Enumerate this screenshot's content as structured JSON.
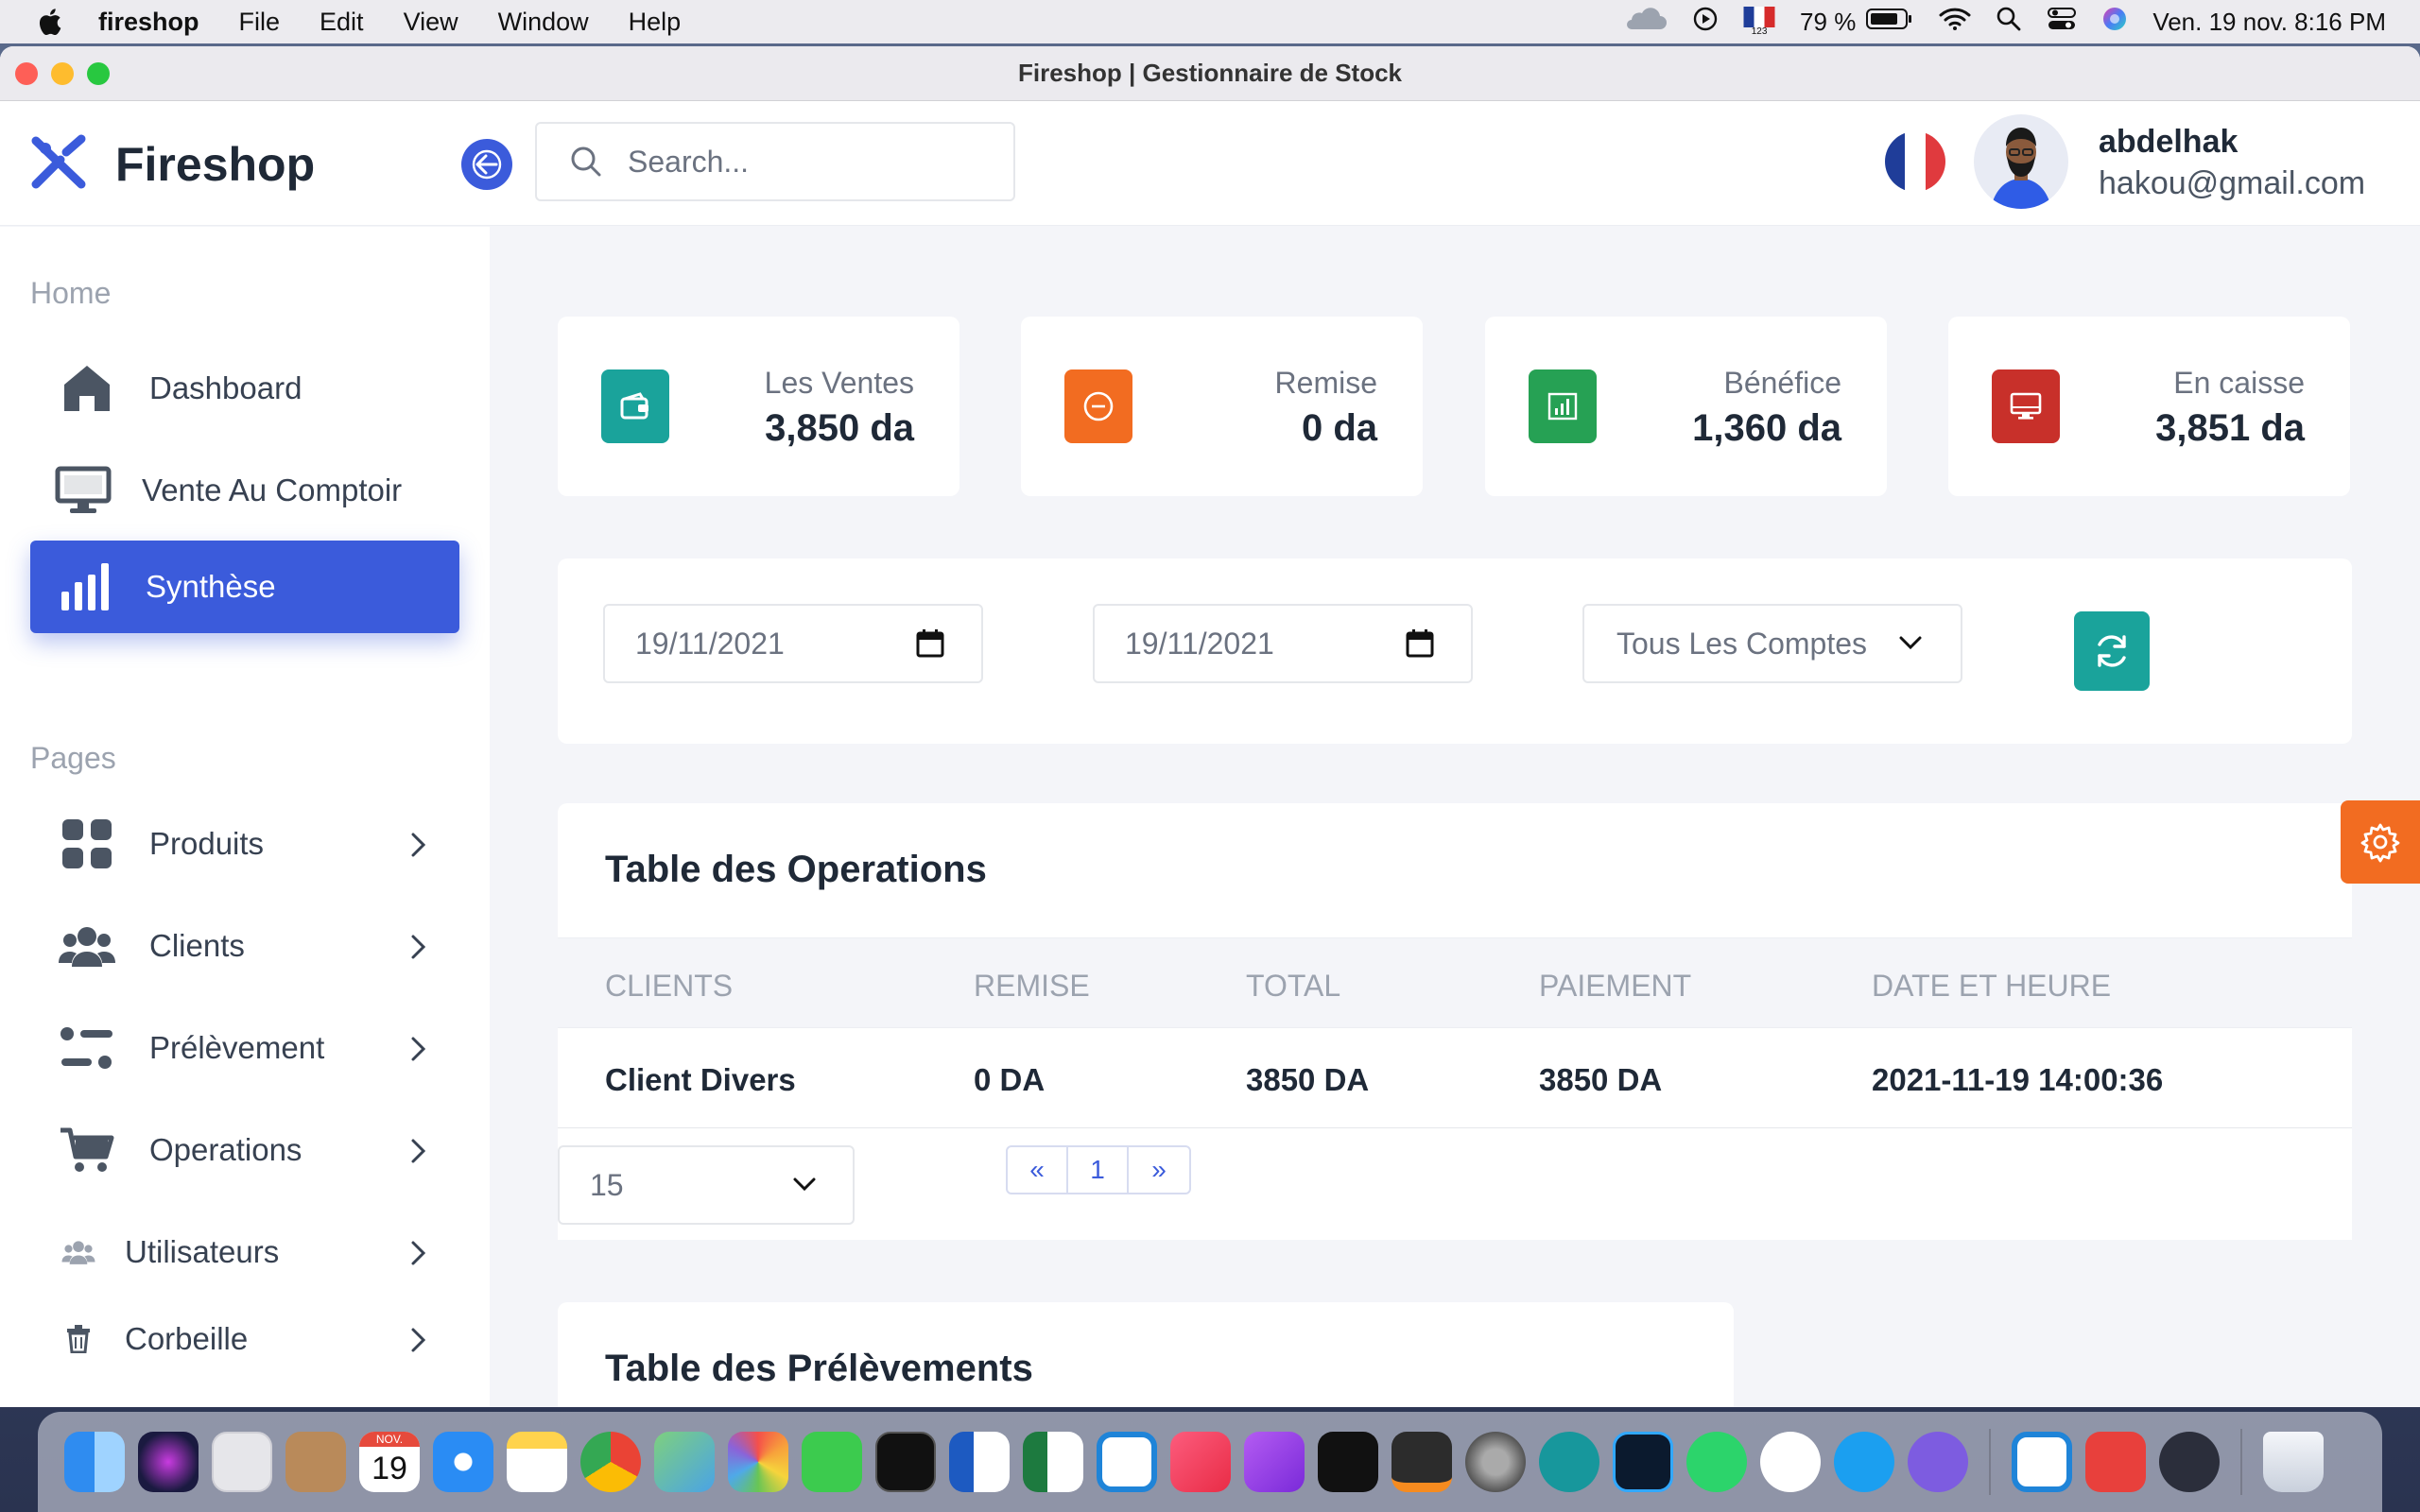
{
  "menubar": {
    "app_name": "fireshop",
    "menus": [
      "File",
      "Edit",
      "View",
      "Window",
      "Help"
    ],
    "battery": "79 %",
    "input_sub": "123",
    "datetime": "Ven. 19 nov.  8:16 PM"
  },
  "window": {
    "title": "Fireshop | Gestionnaire de Stock"
  },
  "header": {
    "brand": "Fireshop",
    "search_placeholder": "Search...",
    "user_name": "abdelhak",
    "user_email": "hakou@gmail.com"
  },
  "sidebar": {
    "section_home": "Home",
    "section_pages": "Pages",
    "items": [
      {
        "label": "Dashboard"
      },
      {
        "label": "Vente Au Comptoir"
      },
      {
        "label": "Synthèse"
      },
      {
        "label": "Produits"
      },
      {
        "label": "Clients"
      },
      {
        "label": "Prélèvement"
      },
      {
        "label": "Operations"
      },
      {
        "label": "Utilisateurs"
      },
      {
        "label": "Corbeille"
      }
    ]
  },
  "stats": [
    {
      "label": "Les Ventes",
      "value": "3,850 da",
      "color": "#1aa39b"
    },
    {
      "label": "Remise",
      "value": "0 da",
      "color": "#f26c21"
    },
    {
      "label": "Bénéfice",
      "value": "1,360 da",
      "color": "#26a154"
    },
    {
      "label": "En caisse",
      "value": "3,851 da",
      "color": "#c8302a"
    }
  ],
  "filters": {
    "date_from": "19/11/2021",
    "date_to": "19/11/2021",
    "account": "Tous Les Comptes"
  },
  "operations": {
    "title": "Table des Operations",
    "columns": [
      "CLIENTS",
      "REMISE",
      "TOTAL",
      "PAIEMENT",
      "DATE ET HEURE"
    ],
    "rows": [
      [
        "Client Divers",
        "0 DA",
        "3850 DA",
        "3850 DA",
        "2021-11-19 14:00:36"
      ]
    ],
    "per_page": "15",
    "pager": [
      "«",
      "1",
      "»"
    ]
  },
  "prelevements": {
    "title": "Table des Prélèvements"
  },
  "dock": {
    "calendar_month": "NOV.",
    "calendar_day": "19"
  },
  "colors": {
    "accent": "#3b5bdb",
    "settings": "#f26c21"
  }
}
